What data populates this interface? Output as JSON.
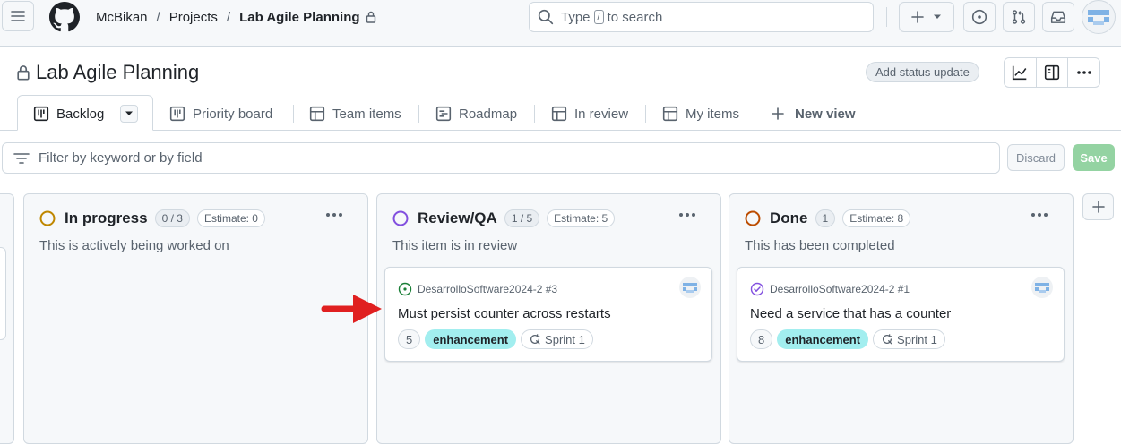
{
  "header": {
    "owner": "McBikan",
    "projects": "Projects",
    "project": "Lab Agile Planning",
    "sep": "/",
    "search_prefix": "Type",
    "search_key": "/",
    "search_suffix": "to search"
  },
  "project": {
    "title": "Lab Agile Planning",
    "status_update": "Add status update"
  },
  "tabs": [
    {
      "label": "Backlog",
      "icon": "board-icon"
    },
    {
      "label": "Priority board",
      "icon": "board-icon"
    },
    {
      "label": "Team items",
      "icon": "table-icon"
    },
    {
      "label": "Roadmap",
      "icon": "roadmap-icon"
    },
    {
      "label": "In review",
      "icon": "table-icon"
    },
    {
      "label": "My items",
      "icon": "table-icon"
    }
  ],
  "new_view": "New view",
  "filter": {
    "placeholder": "Filter by keyword or by field",
    "discard": "Discard",
    "save": "Save"
  },
  "columns": [
    {
      "name": "In progress",
      "count": "0 / 3",
      "estimate": "Estimate: 0",
      "description": "This is actively being worked on",
      "color": "#bf8700"
    },
    {
      "name": "Review/QA",
      "count": "1 / 5",
      "estimate": "Estimate: 5",
      "description": "This item is in review",
      "color": "#8250df",
      "card": {
        "repo": "DesarrolloSoftware2024-2 #3",
        "title": "Must persist counter across restarts",
        "estimate": "5",
        "label": "enhancement",
        "sprint": "Sprint 1",
        "state_icon": "issue-open-icon",
        "state_color": "#1a7f37"
      }
    },
    {
      "name": "Done",
      "count": "1",
      "estimate": "Estimate: 8",
      "description": "This has been completed",
      "color": "#bc4c00",
      "card": {
        "repo": "DesarrolloSoftware2024-2 #1",
        "title": "Need a service that has a counter",
        "estimate": "8",
        "label": "enhancement",
        "sprint": "Sprint 1",
        "state_icon": "issue-closed-icon",
        "state_color": "#8250df"
      }
    }
  ],
  "colors": {
    "label_bg": "#a2eeef",
    "annotation_arrow": "#e02020",
    "save_bg": "#94d3a2"
  }
}
